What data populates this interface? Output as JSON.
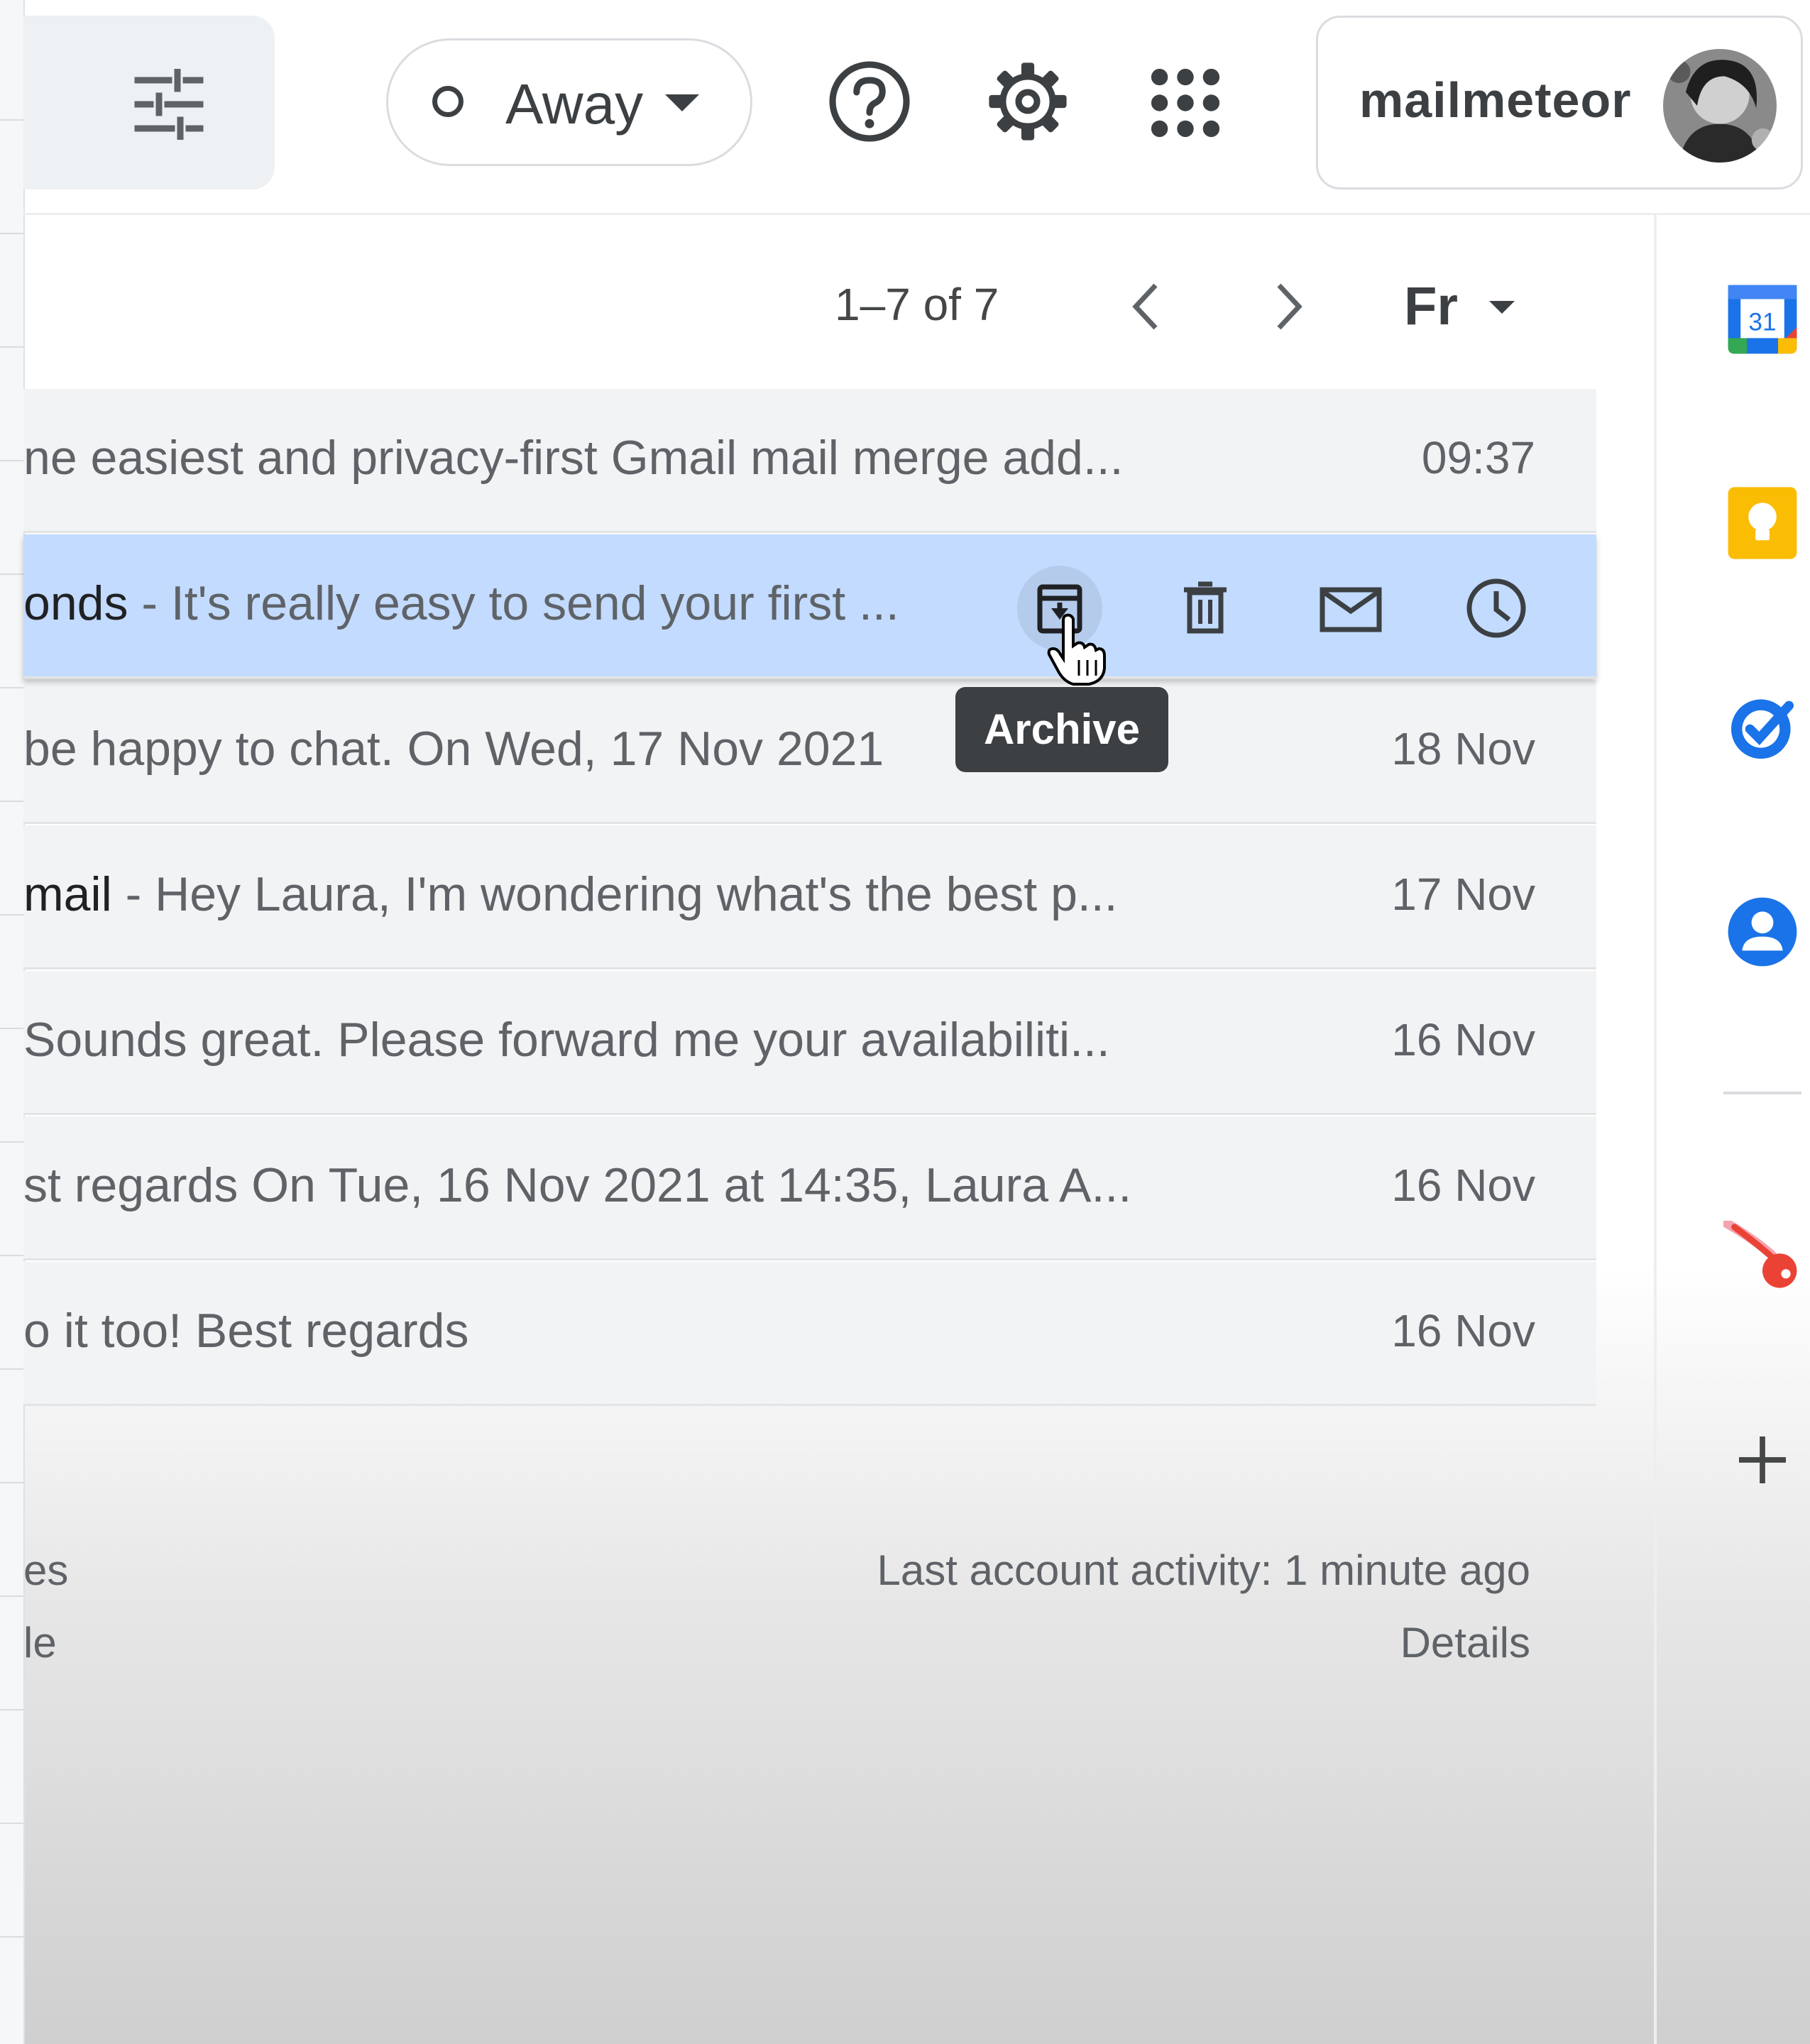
{
  "header": {
    "status": {
      "label": "Away",
      "icon": "status-ring-icon"
    },
    "icons": [
      "search-options-icon",
      "help-icon",
      "settings-gear-icon",
      "apps-grid-icon"
    ],
    "account": {
      "brand": "mailmeteor"
    }
  },
  "toolbar": {
    "pager_text": "1–7 of 7",
    "input_tools_label": "Fr"
  },
  "list": {
    "rows": [
      {
        "sender": "",
        "preview": "ne easiest and privacy-first Gmail mail merge add...",
        "date": "09:37"
      },
      {
        "sender": "onds",
        "preview": " - It's really easy to send your first ...",
        "date": ""
      },
      {
        "sender": "",
        "preview": " be happy to chat. On Wed, 17 Nov 2021",
        "date": "18 Nov"
      },
      {
        "sender": "mail",
        "preview": " - Hey Laura, I'm wondering what's the best p...",
        "date": "17 Nov"
      },
      {
        "sender": "",
        "preview": "Sounds great. Please forward me your availabiliti...",
        "date": "16 Nov"
      },
      {
        "sender": "",
        "preview": "st regards On Tue, 16 Nov 2021 at 14:35, Laura A...",
        "date": "16 Nov"
      },
      {
        "sender": "",
        "preview": "o it too! Best regards",
        "date": "16 Nov"
      }
    ],
    "hover_actions": [
      "archive-icon",
      "delete-icon",
      "mark-unread-icon",
      "snooze-icon"
    ],
    "tooltip": "Archive"
  },
  "footer": {
    "left_line1": "es",
    "left_line2": "le",
    "activity": "Last account activity: 1 minute ago",
    "details": "Details"
  },
  "side_panel": {
    "calendar_day": "31",
    "icons": [
      "calendar-icon",
      "keep-icon",
      "tasks-icon",
      "contacts-icon",
      "mailmeteor-icon",
      "add-icon"
    ]
  },
  "colors": {
    "accent_blue": "#1a73e8",
    "active_row": "#c2dbff",
    "keep_yellow": "#fbbc04",
    "mailmeteor_red": "#ea4335"
  }
}
